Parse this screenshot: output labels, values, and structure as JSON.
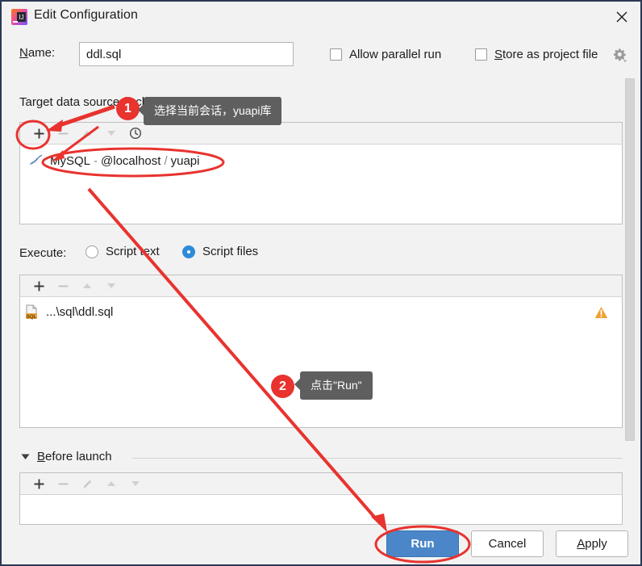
{
  "window": {
    "title": "Edit Configuration",
    "app_icon": "intellij-idea-icon",
    "close_icon": "close-icon"
  },
  "name_row": {
    "label_prefix": "N",
    "label_rest": "ame:",
    "value": "ddl.sql",
    "placeholder": ""
  },
  "options": {
    "allow_parallel_run": {
      "label": "Allow parallel run",
      "checked": false
    },
    "store_as_project_file": {
      "label_prefix": "S",
      "label_rest": "tore as project file",
      "checked": false
    },
    "gear_icon": "gear-icon"
  },
  "target_section": {
    "label": "Target data source / schema:",
    "toolbar": [
      {
        "icon": "plus-icon",
        "name": "add-data-source-button",
        "enabled": true
      },
      {
        "icon": "minus-icon",
        "name": "remove-data-source-button",
        "enabled": false
      },
      {
        "icon": "arrow-up-icon",
        "name": "move-up-button",
        "enabled": false
      },
      {
        "icon": "arrow-down-icon",
        "name": "move-down-button",
        "enabled": false
      },
      {
        "icon": "clock-icon",
        "name": "history-button",
        "enabled": true
      }
    ],
    "rows": [
      {
        "icon": "mysql-icon",
        "name": "MySQL",
        "dash": "-",
        "host": "@localhost",
        "separator": "/",
        "schema": "yuapi"
      }
    ]
  },
  "execute_section": {
    "label": "Execute:",
    "options": [
      {
        "label": "Script text",
        "selected": false
      },
      {
        "label": "Script files",
        "selected": true
      }
    ],
    "toolbar": [
      {
        "icon": "plus-icon",
        "name": "add-script-file-button",
        "enabled": true
      },
      {
        "icon": "minus-icon",
        "name": "remove-script-file-button",
        "enabled": false
      },
      {
        "icon": "arrow-up-icon",
        "name": "script-move-up-button",
        "enabled": false
      },
      {
        "icon": "arrow-down-icon",
        "name": "script-move-down-button",
        "enabled": false
      }
    ],
    "rows": [
      {
        "icon": "sql-file-icon",
        "path": "...\\sql\\ddl.sql",
        "status_icon": "warning-icon"
      }
    ]
  },
  "before_launch": {
    "label_prefix": "B",
    "label_rest": "efore launch",
    "expanded": true,
    "collapse_icon": "triangle-down-icon",
    "toolbar": [
      {
        "icon": "plus-icon",
        "name": "add-task-button",
        "enabled": true
      },
      {
        "icon": "minus-icon",
        "name": "remove-task-button",
        "enabled": false
      },
      {
        "icon": "pencil-icon",
        "name": "edit-task-button",
        "enabled": false
      },
      {
        "icon": "arrow-up-icon",
        "name": "task-move-up-button",
        "enabled": false
      },
      {
        "icon": "arrow-down-icon",
        "name": "task-move-down-button",
        "enabled": false
      }
    ],
    "rows": []
  },
  "buttons": {
    "run": "Run",
    "cancel": "Cancel",
    "apply_prefix": "A",
    "apply_rest": "pply"
  },
  "annotations": {
    "accent_color": "#e8332f",
    "tooltip_bg": "#5f5f5f",
    "items": [
      {
        "badge": "1",
        "tooltip": "选择当前会话，yuapi库"
      },
      {
        "badge": "2",
        "tooltip": "点击\"Run\""
      }
    ]
  },
  "colors": {
    "dialog_bg": "#f2f2f2",
    "panel_bg": "#ffffff",
    "run_button": "#4a86c8",
    "radio_selected": "#2f8ad8",
    "warning": "#f0a030"
  },
  "scrollbar": {
    "name": "vertical-scrollbar",
    "visible": true
  }
}
